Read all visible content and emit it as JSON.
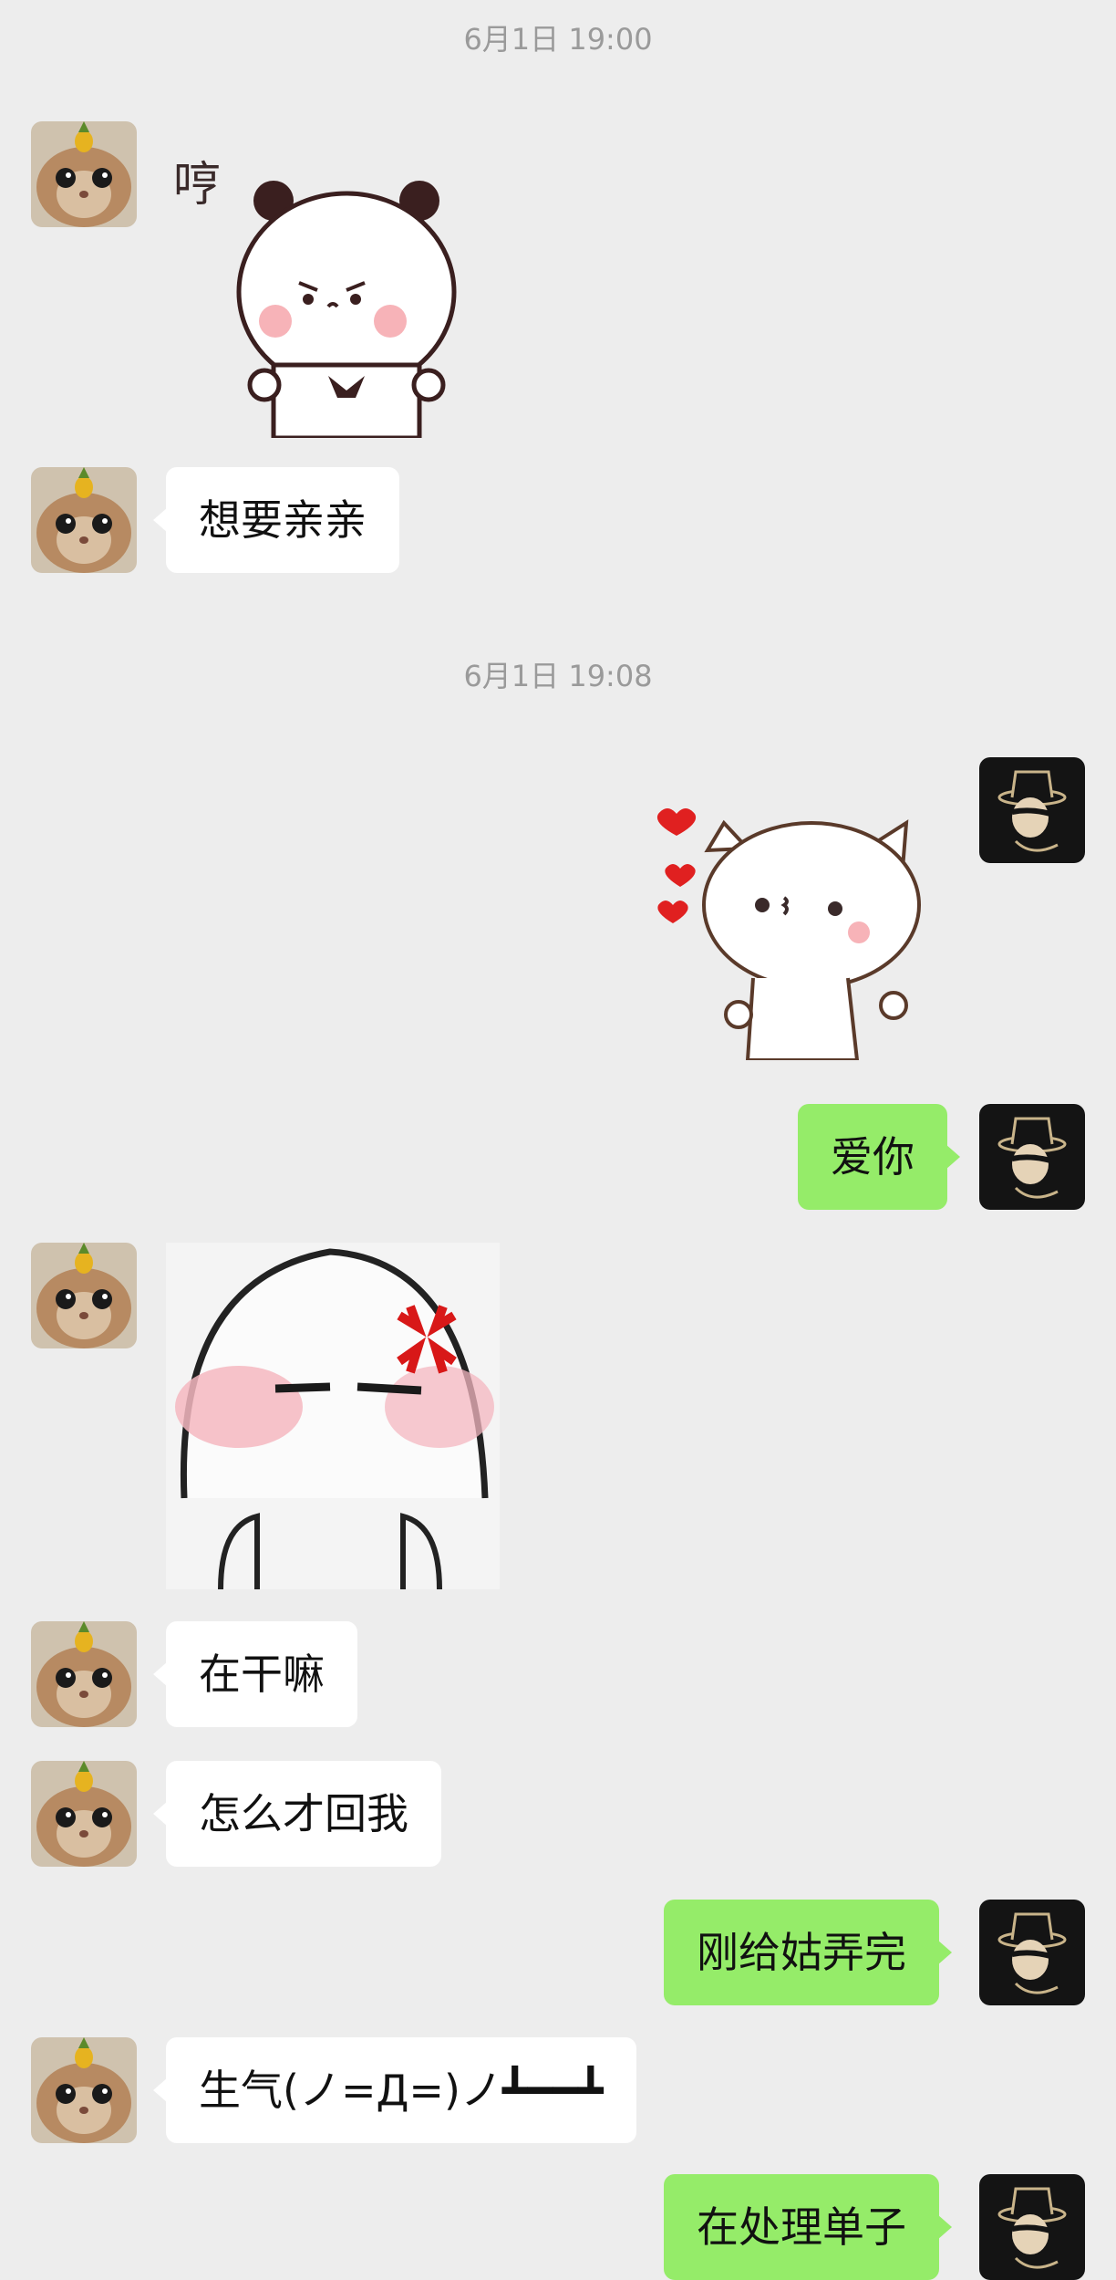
{
  "chat": {
    "messages": [
      {
        "type": "timestamp",
        "text": "6月1日 19:00"
      },
      {
        "type": "sticker",
        "side": "left",
        "sticker": "panda-hmph-sticker",
        "text": "哼"
      },
      {
        "type": "text",
        "side": "left",
        "text": "想要亲亲"
      },
      {
        "type": "timestamp",
        "text": "6月1日 19:08"
      },
      {
        "type": "sticker",
        "side": "right",
        "sticker": "cat-kiss-hearts-sticker"
      },
      {
        "type": "text",
        "side": "right",
        "text": "爱你"
      },
      {
        "type": "sticker",
        "side": "left",
        "sticker": "angry-blushing-face-sticker"
      },
      {
        "type": "text",
        "side": "left",
        "text": "在干嘛"
      },
      {
        "type": "text",
        "side": "left",
        "text": "怎么才回我"
      },
      {
        "type": "text",
        "side": "right",
        "text": "刚给姑弄完"
      },
      {
        "type": "text",
        "side": "left",
        "text": "生气(ノ=Д=)ノ┻━━┻"
      },
      {
        "type": "text",
        "side": "right",
        "text": "在处理单子"
      }
    ]
  },
  "colors": {
    "background": "#ededed",
    "bubble_self": "#95ec69",
    "bubble_other": "#ffffff",
    "timestamp": "#9a9a9a"
  },
  "icons": {
    "left_avatar": "cat-with-pineapple-avatar",
    "right_avatar": "man-in-hat-avatar"
  }
}
